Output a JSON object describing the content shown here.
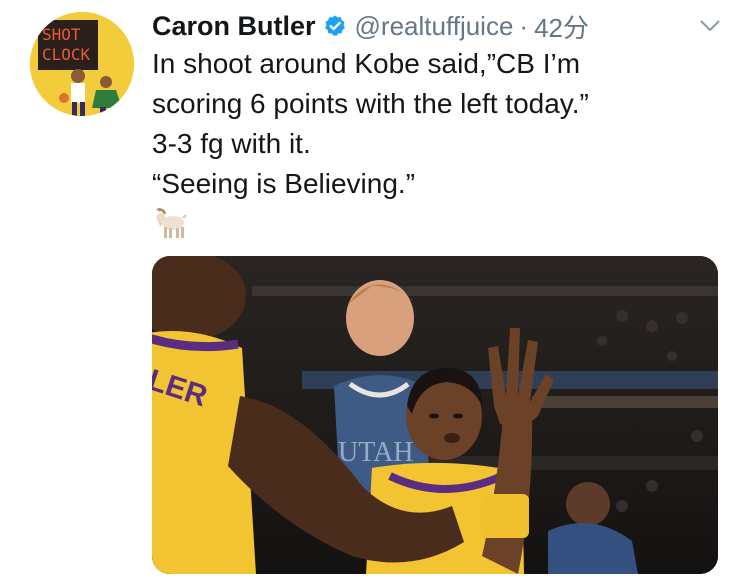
{
  "author": {
    "name": "Caron Butler",
    "handle": "@realtuffjuice",
    "time": "42分",
    "avatar_text_top": "SHOT",
    "avatar_text_bottom": "CLOCK"
  },
  "tweet": {
    "lines": [
      "In shoot around Kobe said,”CB I’m",
      "scoring 6 points with the left today.”",
      "3-3 fg with it.",
      "“Seeing is Believing.”"
    ],
    "emoji": "goat"
  },
  "media": {
    "jersey_text_left": "LER",
    "jersey_text_center": "UTAH"
  },
  "colors": {
    "verified_blue": "#1da1f2",
    "avatar_yellow": "#f2cc3a",
    "lakers_gold": "#f3c431",
    "lakers_purple": "#5b2d82",
    "meta_gray": "#657786"
  },
  "icons": {
    "verified": "verified-badge-icon",
    "menu": "chevron-down-icon",
    "emoji": "goat-emoji-icon"
  }
}
